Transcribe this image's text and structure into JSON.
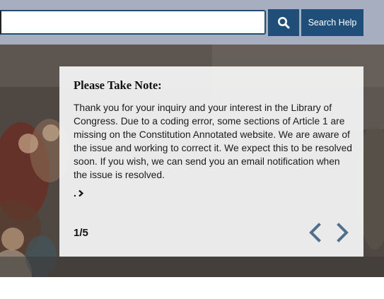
{
  "search": {
    "value": "",
    "placeholder": "",
    "button_icon": "search-icon",
    "help_label": "Search Help"
  },
  "notice": {
    "title": "Please Take Note:",
    "body": "Thank you for your inquiry and your interest in the Library of Congress. Due to a coding error, some sections of Article 1 are missing on the Constitution Annotated website. We are aware of the issue and working to correct it. We expect this to be resolved soon. If you wish, we can send you an email notification when the issue is resolved.",
    "link_label": ".",
    "link_icon": "chevron-right-icon",
    "counter": "1/5",
    "prev_icon": "chevron-left-icon",
    "next_icon": "chevron-right-icon"
  },
  "colors": {
    "search_band": "#a7aec0",
    "brand_blue": "#1f4f79",
    "arrow_slate": "#4f6f8c",
    "modal_bg": "#f3f3f3"
  }
}
